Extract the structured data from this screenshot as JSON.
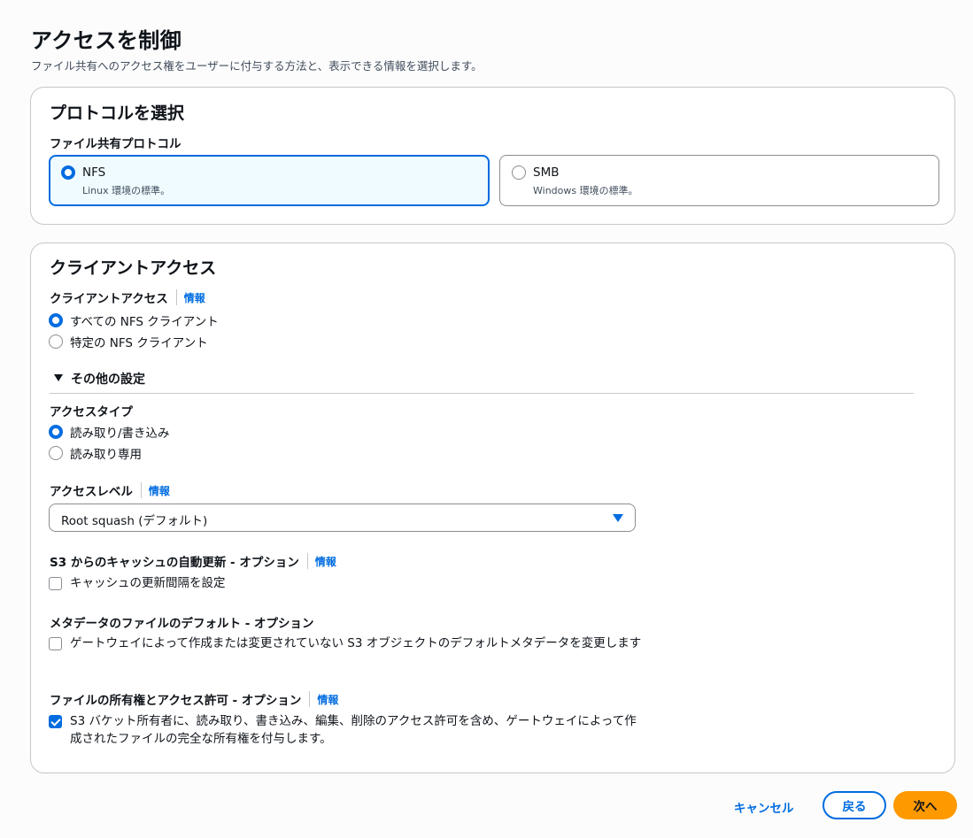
{
  "page": {
    "title": "アクセスを制御",
    "description": "ファイル共有へのアクセス権をユーザーに付与する方法と、表示できる情報を選択します。"
  },
  "protocol_panel": {
    "title": "プロトコルを選択",
    "field_label": "ファイル共有プロトコル",
    "options": [
      {
        "label": "NFS",
        "description": "Linux 環境の標準。",
        "selected": true
      },
      {
        "label": "SMB",
        "description": "Windows 環境の標準。",
        "selected": false
      }
    ]
  },
  "client_panel": {
    "title": "クライアントアクセス",
    "client_access": {
      "label": "クライアントアクセス",
      "info": "情報",
      "options": [
        {
          "label": "すべての NFS クライアント",
          "selected": true
        },
        {
          "label": "特定の NFS クライアント",
          "selected": false
        }
      ]
    },
    "other_settings": {
      "label": "その他の設定",
      "expanded": true
    },
    "access_type": {
      "label": "アクセスタイプ",
      "options": [
        {
          "label": "読み取り/書き込み",
          "selected": true
        },
        {
          "label": "読み取り専用",
          "selected": false
        }
      ]
    },
    "access_level": {
      "label": "アクセスレベル",
      "info": "情報",
      "value": "Root squash (デフォルト)"
    },
    "cache_refresh": {
      "label": "S3 からのキャッシュの自動更新 - オプション",
      "info": "情報",
      "checkbox_label": "キャッシュの更新間隔を設定",
      "checked": false
    },
    "metadata_defaults": {
      "label": "メタデータのファイルのデフォルト - オプション",
      "checkbox_label": "ゲートウェイによって作成または変更されていない S3 オブジェクトのデフォルトメタデータを変更します",
      "checked": false
    },
    "ownership": {
      "label": "ファイルの所有権とアクセス許可 - オプション",
      "info": "情報",
      "checkbox_label": "S3 バケット所有者に、読み取り、書き込み、編集、削除のアクセス許可を含め、ゲートウェイによって作成されたファイルの完全な所有権を付与します。",
      "checked": true
    }
  },
  "footer": {
    "cancel": "キャンセル",
    "back": "戻る",
    "next": "次へ"
  },
  "colors": {
    "accent": "#006ce0",
    "primary_button": "#ff9900",
    "selected_tile_bg": "#f0fbff"
  }
}
